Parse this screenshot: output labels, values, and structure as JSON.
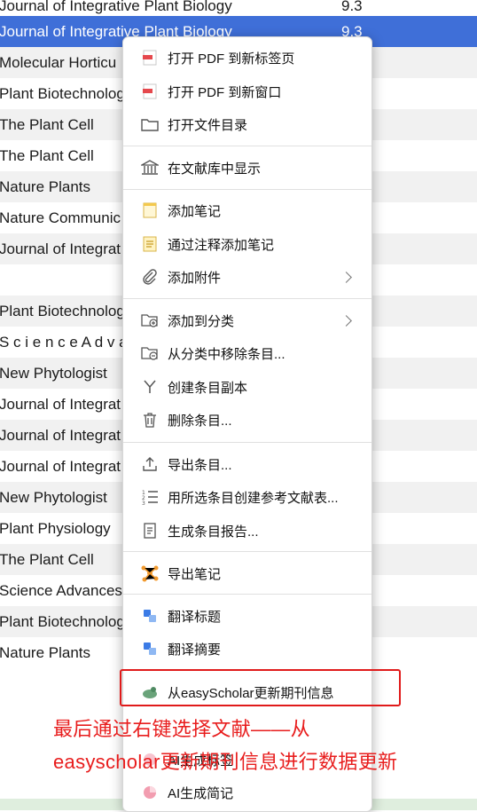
{
  "list": {
    "rows": [
      {
        "title": "Journal of Integrative Plant Biology",
        "value": "9.3"
      },
      {
        "title": "Journal of Integrative Plant Biology",
        "value": "9.3"
      },
      {
        "title": "Molecular Horticu",
        "value": ""
      },
      {
        "title": "Plant Biotechnolog",
        "value": ""
      },
      {
        "title": "The Plant Cell",
        "value": ""
      },
      {
        "title": "The Plant Cell",
        "value": ""
      },
      {
        "title": "Nature Plants",
        "value": ""
      },
      {
        "title": "Nature Communic",
        "value": ""
      },
      {
        "title": "Journal of Integrat",
        "value": ""
      },
      {
        "title": "",
        "value": ""
      },
      {
        "title": "Plant Biotechnolog",
        "value": ""
      },
      {
        "title": "S c i e n c e  A d v a",
        "value": ""
      },
      {
        "title": "New Phytologist",
        "value": ""
      },
      {
        "title": "Journal of Integrat",
        "value": ""
      },
      {
        "title": "Journal of Integrat",
        "value": ""
      },
      {
        "title": "Journal of Integrat",
        "value": ""
      },
      {
        "title": "New Phytologist",
        "value": ""
      },
      {
        "title": "Plant Physiology",
        "value": ""
      },
      {
        "title": "The Plant Cell",
        "value": ""
      },
      {
        "title": "Science Advances",
        "value": ""
      },
      {
        "title": "Plant Biotechnolog",
        "value": ""
      },
      {
        "title": "Nature Plants",
        "value": ""
      }
    ]
  },
  "menu": {
    "open_pdf_tab": "打开 PDF 到新标签页",
    "open_pdf_window": "打开 PDF 到新窗口",
    "open_folder": "打开文件目录",
    "show_in_library": "在文献库中显示",
    "add_note": "添加笔记",
    "add_note_from_annotations": "通过注释添加笔记",
    "add_attachment": "添加附件",
    "add_to_collection": "添加到分类",
    "remove_from_collection": "从分类中移除条目...",
    "duplicate_item": "创建条目副本",
    "delete_item": "删除条目...",
    "export_item": "导出条目...",
    "create_bibliography": "用所选条目创建参考文献表...",
    "generate_report": "生成条目报告...",
    "export_notes": "导出笔记",
    "translate_title": "翻译标题",
    "translate_abstract": "翻译摘要",
    "easyscholar_update": "从easyScholar更新期刊信息",
    "ai_tags": "AI生成标签",
    "ai_notes": "AI生成简记"
  },
  "annotation": {
    "line1": "最后通过右键选择文献——从",
    "line2": "easyscholar更新期刊信息进行数据更新"
  },
  "colors": {
    "selection": "#3f6fd8",
    "annotation_red": "#e81d1d"
  }
}
